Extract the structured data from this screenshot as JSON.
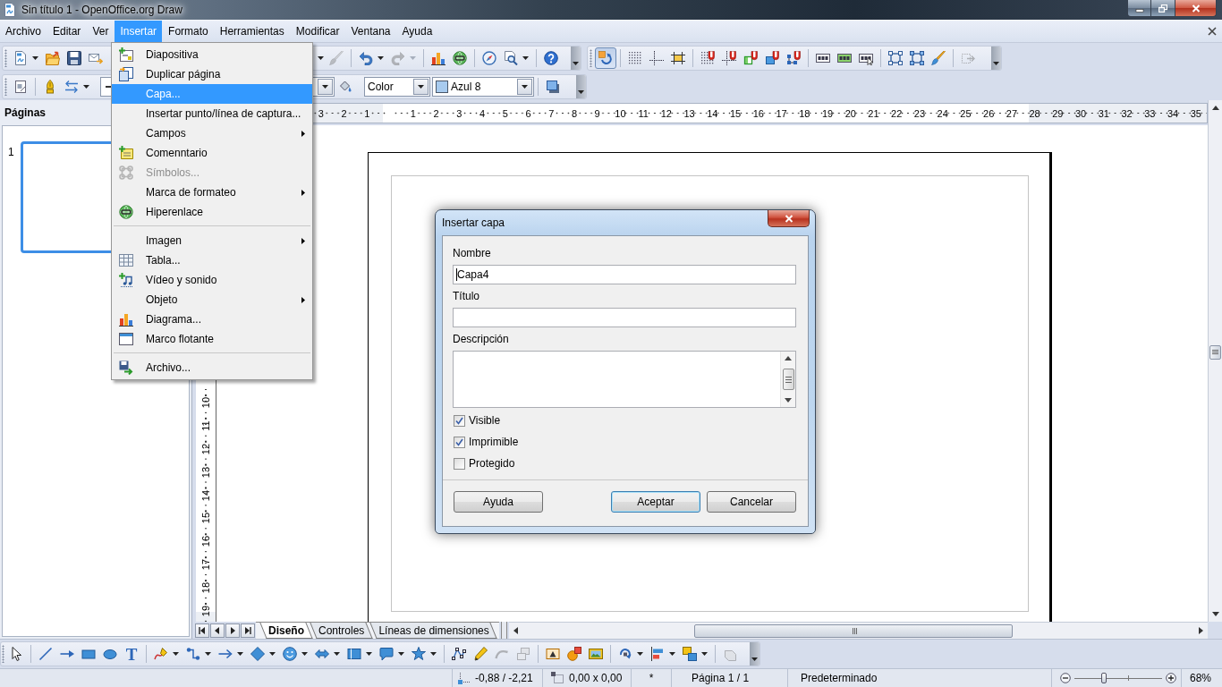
{
  "window": {
    "title": "Sin título 1 - OpenOffice.org Draw"
  },
  "menu_bar": [
    {
      "label": "Archivo",
      "selected": false
    },
    {
      "label": "Editar",
      "selected": false
    },
    {
      "label": "Ver",
      "selected": false
    },
    {
      "label": "Insertar",
      "selected": true
    },
    {
      "label": "Formato",
      "selected": false
    },
    {
      "label": "Herramientas",
      "selected": false
    },
    {
      "label": "Modificar",
      "selected": false
    },
    {
      "label": "Ventana",
      "selected": false
    },
    {
      "label": "Ayuda",
      "selected": false
    }
  ],
  "standard_toolbar": [
    {
      "kind": "split",
      "disabled": false
    },
    {
      "kind": "button",
      "disabled": false
    },
    {
      "kind": "button",
      "disabled": false
    },
    {
      "kind": "button",
      "disabled": false
    },
    {
      "kind": "caret",
      "disabled": false
    },
    {
      "kind": "button",
      "disabled": true
    },
    {
      "kind": "separator"
    },
    {
      "kind": "split",
      "disabled": false
    },
    {
      "kind": "split",
      "disabled": true
    },
    {
      "kind": "separator"
    },
    {
      "kind": "button",
      "disabled": false
    },
    {
      "kind": "button",
      "disabled": false
    },
    {
      "kind": "separator"
    },
    {
      "kind": "button",
      "disabled": false
    },
    {
      "kind": "split",
      "disabled": false
    },
    {
      "kind": "separator"
    },
    {
      "kind": "button",
      "disabled": false
    }
  ],
  "options_toolbar": [
    {
      "kind": "button",
      "pressed": true,
      "disabled": false
    },
    {
      "kind": "separator"
    },
    {
      "kind": "button",
      "pressed": false,
      "disabled": false
    },
    {
      "kind": "button",
      "pressed": false,
      "disabled": false
    },
    {
      "kind": "button",
      "pressed": false,
      "disabled": false
    },
    {
      "kind": "separator"
    },
    {
      "kind": "button",
      "pressed": false,
      "disabled": false
    },
    {
      "kind": "button",
      "pressed": false,
      "disabled": false
    },
    {
      "kind": "button",
      "pressed": false,
      "disabled": false
    },
    {
      "kind": "button",
      "pressed": false,
      "disabled": false
    },
    {
      "kind": "button",
      "pressed": false,
      "disabled": false
    },
    {
      "kind": "separator"
    },
    {
      "kind": "button",
      "pressed": false,
      "disabled": false
    },
    {
      "kind": "button",
      "pressed": false,
      "disabled": false
    },
    {
      "kind": "button",
      "pressed": false,
      "disabled": false
    },
    {
      "kind": "separator"
    },
    {
      "kind": "button",
      "pressed": false,
      "disabled": false
    },
    {
      "kind": "button",
      "pressed": false,
      "disabled": false
    },
    {
      "kind": "button",
      "pressed": false,
      "disabled": false
    },
    {
      "kind": "separator"
    },
    {
      "kind": "button",
      "pressed": false,
      "disabled": true
    }
  ],
  "line_toolbar": [
    {
      "kind": "button"
    },
    {
      "kind": "separator"
    },
    {
      "kind": "button"
    },
    {
      "kind": "split"
    },
    {
      "kind": "line-combo"
    },
    {
      "kind": "button"
    },
    {
      "kind": "combo",
      "value": "Color"
    },
    {
      "kind": "color-combo",
      "value": "Azul 8",
      "color": "#a8cbef"
    },
    {
      "kind": "separator"
    },
    {
      "kind": "button"
    }
  ],
  "insert_menu": [
    {
      "kind": "item",
      "label": "Diapositiva",
      "selected": false,
      "disabled": false
    },
    {
      "kind": "item",
      "label": "Duplicar página",
      "selected": false,
      "disabled": false
    },
    {
      "kind": "item",
      "label": "Capa...",
      "selected": true,
      "disabled": false
    },
    {
      "kind": "item",
      "label": "Insertar punto/línea de captura...",
      "selected": false,
      "disabled": false
    },
    {
      "kind": "submenu",
      "label": "Campos",
      "selected": false,
      "disabled": false
    },
    {
      "kind": "item",
      "label": "Comenntario",
      "selected": false,
      "disabled": false
    },
    {
      "kind": "item",
      "label": "Símbolos...",
      "selected": false,
      "disabled": true
    },
    {
      "kind": "submenu",
      "label": "Marca de formateo",
      "selected": false,
      "disabled": false
    },
    {
      "kind": "item",
      "label": "Hiperenlace",
      "selected": false,
      "disabled": false
    },
    {
      "kind": "separator"
    },
    {
      "kind": "submenu",
      "label": "Imagen",
      "selected": false,
      "disabled": false
    },
    {
      "kind": "item",
      "label": "Tabla...",
      "selected": false,
      "disabled": false
    },
    {
      "kind": "item",
      "label": "Vídeo y sonido",
      "selected": false,
      "disabled": false
    },
    {
      "kind": "submenu",
      "label": "Objeto",
      "selected": false,
      "disabled": false
    },
    {
      "kind": "item",
      "label": "Diagrama...",
      "selected": false,
      "disabled": false
    },
    {
      "kind": "item",
      "label": "Marco flotante",
      "selected": false,
      "disabled": false
    },
    {
      "kind": "separator"
    },
    {
      "kind": "item",
      "label": "Archivo...",
      "selected": false,
      "disabled": false
    }
  ],
  "pages_panel": {
    "title": "Páginas",
    "pages": [
      {
        "number": "1",
        "selected": true
      }
    ]
  },
  "horizontal_ruler": {
    "left_labels": [
      "3",
      "2",
      "1"
    ],
    "right_labels": [
      "1",
      "2",
      "3",
      "4",
      "5",
      "6",
      "7",
      "8",
      "9",
      "10",
      "11",
      "12",
      "13",
      "14",
      "15",
      "16",
      "17",
      "18",
      "19",
      "20",
      "21",
      "22",
      "23",
      "24",
      "25",
      "26",
      "27",
      "28",
      "29",
      "30",
      "31",
      "32",
      "33",
      "34",
      "35"
    ]
  },
  "vertical_ruler": {
    "labels": [
      "10",
      "11",
      "12",
      "13",
      "14",
      "15",
      "16",
      "17",
      "18",
      "19"
    ]
  },
  "layer_tabs": [
    {
      "label": "Diseño",
      "selected": true
    },
    {
      "label": "Controles",
      "selected": false
    },
    {
      "label": "Líneas de dimensiones",
      "selected": false
    }
  ],
  "dialog": {
    "title": "Insertar capa",
    "fields": [
      {
        "label": "Nombre",
        "kind": "text",
        "value": "Capa4",
        "focused": true
      },
      {
        "label": "Título",
        "kind": "text",
        "focused": false
      },
      {
        "label": "Descripción",
        "kind": "textarea",
        "focused": false
      }
    ],
    "checkboxes": [
      {
        "label": "Visible",
        "checked": true
      },
      {
        "label": "Imprimible",
        "checked": true
      },
      {
        "label": "Protegido",
        "checked": false
      }
    ],
    "buttons": [
      {
        "label": "Ayuda",
        "default": false
      },
      {
        "label": "Aceptar",
        "default": true
      },
      {
        "label": "Cancelar",
        "default": false
      }
    ]
  },
  "drawing_toolbar": [
    {
      "kind": "button",
      "disabled": false
    },
    {
      "kind": "separator"
    },
    {
      "kind": "button",
      "disabled": false
    },
    {
      "kind": "button",
      "disabled": false
    },
    {
      "kind": "button",
      "disabled": false
    },
    {
      "kind": "button",
      "disabled": false
    },
    {
      "kind": "text",
      "label": "T",
      "disabled": false
    },
    {
      "kind": "separator"
    },
    {
      "kind": "split",
      "disabled": false
    },
    {
      "kind": "split",
      "disabled": false
    },
    {
      "kind": "split",
      "disabled": false
    },
    {
      "kind": "split",
      "disabled": false
    },
    {
      "kind": "split",
      "disabled": false
    },
    {
      "kind": "split",
      "disabled": false
    },
    {
      "kind": "split",
      "disabled": false
    },
    {
      "kind": "split",
      "disabled": false
    },
    {
      "kind": "split",
      "disabled": false
    },
    {
      "kind": "separator"
    },
    {
      "kind": "button",
      "disabled": false
    },
    {
      "kind": "button",
      "disabled": false
    },
    {
      "kind": "button",
      "disabled": true
    },
    {
      "kind": "button",
      "disabled": true
    },
    {
      "kind": "separator"
    },
    {
      "kind": "button",
      "disabled": false
    },
    {
      "kind": "button",
      "disabled": false
    },
    {
      "kind": "button",
      "disabled": false
    },
    {
      "kind": "separator"
    },
    {
      "kind": "split",
      "disabled": false
    },
    {
      "kind": "split",
      "disabled": false
    },
    {
      "kind": "split",
      "disabled": false
    },
    {
      "kind": "separator"
    },
    {
      "kind": "button",
      "disabled": true
    }
  ],
  "status_bar": {
    "position": "-0,88 / -2,21",
    "size": "0,00 x 0,00",
    "modified": "*",
    "page": "Página 1 / 1",
    "layout": "Predeterminado",
    "zoom": {
      "level": 0.34
    },
    "zoom_percent": "68%"
  }
}
